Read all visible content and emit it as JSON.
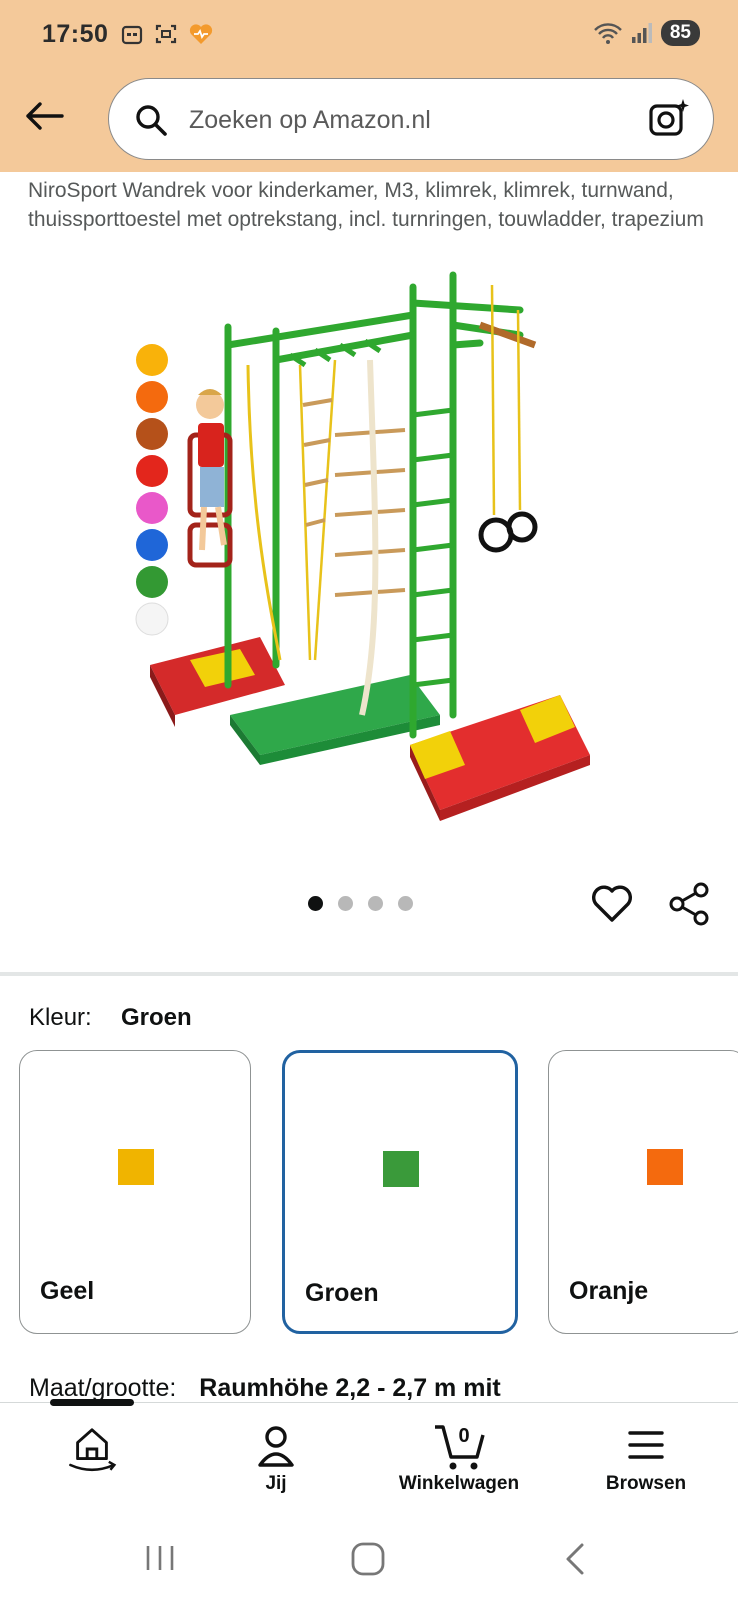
{
  "status_bar": {
    "time": "17:50",
    "battery": "85"
  },
  "search": {
    "placeholder": "Zoeken op Amazon.nl"
  },
  "product": {
    "title": "NiroSport Wandrek voor kinderkamer, M3, klimrek, klimrek, turnwand, thuissporttoestel met optrekstang, incl. turnringen, touwladder, trapezium",
    "image_count": 4,
    "active_image_index": 0
  },
  "color_selector": {
    "label": "Kleur:",
    "selected": "Groen",
    "options": [
      {
        "label": "Geel",
        "color": "#f0b400",
        "selected": false
      },
      {
        "label": "Groen",
        "color": "#3a9a3a",
        "selected": true
      },
      {
        "label": "Oranje",
        "color": "#f46a0e",
        "selected": false
      }
    ]
  },
  "size_selector": {
    "label": "Maat/grootte:",
    "value": "Raumhöhe 2,2 - 2,7 m mit"
  },
  "bottom_nav": {
    "items": [
      {
        "id": "home",
        "label": ""
      },
      {
        "id": "account",
        "label": "Jij"
      },
      {
        "id": "cart",
        "label": "Winkelwagen",
        "count": "0"
      },
      {
        "id": "menu",
        "label": "Browsen"
      }
    ]
  },
  "colors": {
    "header_bg": "#f4c99a",
    "selected_border": "#2162a1",
    "product_green": "#2fa82f"
  }
}
